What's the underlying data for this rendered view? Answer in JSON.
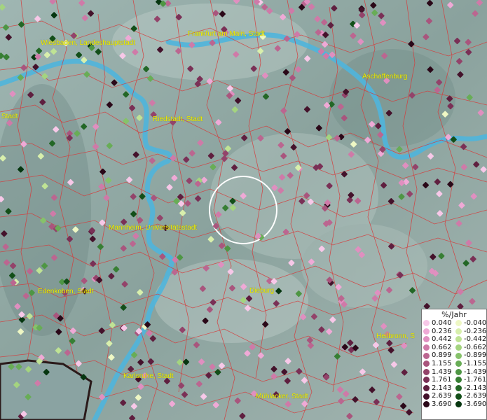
{
  "cities": [
    {
      "name": "Wiesbaden, Landeshauptstadt"
    },
    {
      "name": "Frankfurt am Main, Stadt"
    },
    {
      "name": "Aschaffenburg"
    },
    {
      "name": "Stadt"
    },
    {
      "name": "Riedstadt, Stadt"
    },
    {
      "name": "Mannheim, Universitätsstadt"
    },
    {
      "name": "Edenkoben, Stadt"
    },
    {
      "name": "Dieburg"
    },
    {
      "name": "Heilbronn, S"
    },
    {
      "name": "Karlsruhe, Stadt"
    },
    {
      "name": "Mühlacker, Stadt"
    }
  ],
  "legend": {
    "title": "%/Jahr",
    "positive": [
      "0.040",
      "0.236",
      "0.442",
      "0.662",
      "0.899",
      "1.155",
      "1.439",
      "1.761",
      "2.143",
      "2.639",
      "3.690"
    ],
    "negative": [
      "-0.040",
      "-0.236",
      "-0.442",
      "-0.662",
      "-0.899",
      "-1.155",
      "-1.439",
      "-1.761",
      "-2.143",
      "-2.639",
      "-3.690"
    ],
    "positive_colors": [
      "#f7c8e8",
      "#efa9d6",
      "#e08fc0",
      "#cf7aa8",
      "#bb6690",
      "#a9557d",
      "#93436a",
      "#7a3056",
      "#5f1f3f",
      "#44122b",
      "#2a0818"
    ],
    "negative_colors": [
      "#eef7c4",
      "#d8efac",
      "#bfe394",
      "#a4d47f",
      "#86c26a",
      "#68ad56",
      "#4e9644",
      "#377f34",
      "#236726",
      "#134f19",
      "#063610"
    ]
  },
  "map_colors": {
    "terrain": "#8fa7a2",
    "river": "#4fb5dc",
    "boundary": "#d63a3a",
    "label": "#f2f000"
  }
}
